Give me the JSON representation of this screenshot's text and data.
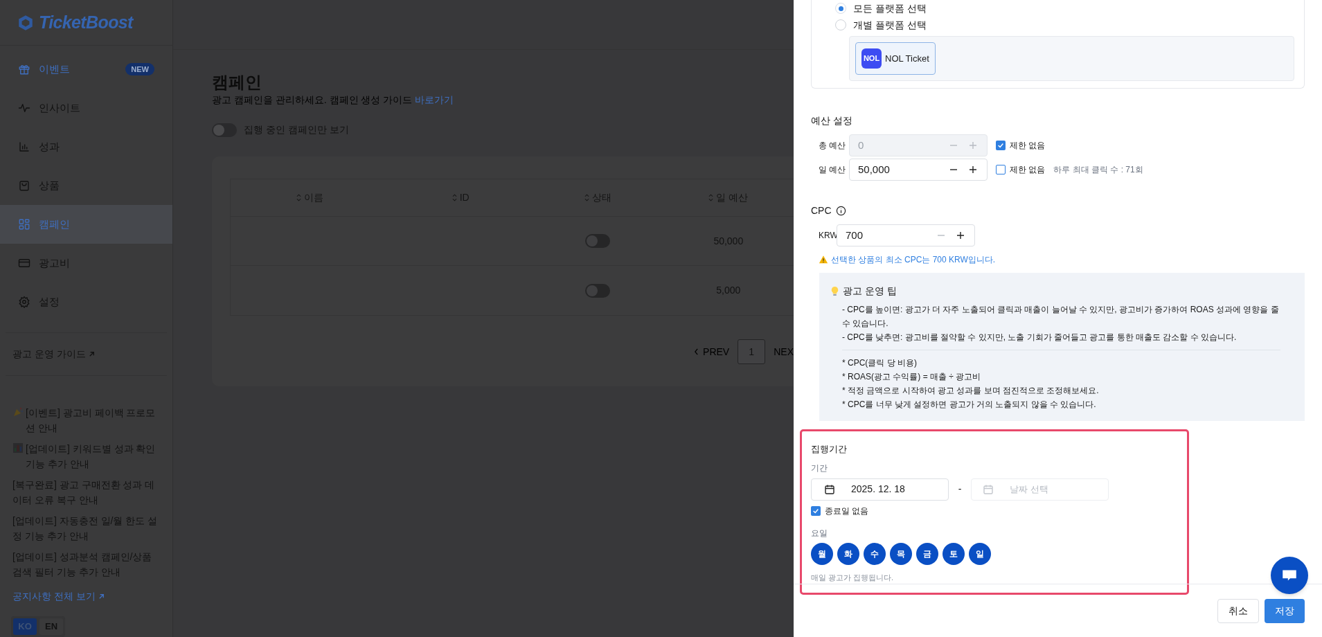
{
  "brand": {
    "name": "TicketBoost"
  },
  "sidebar": {
    "items": [
      {
        "label": "이벤트",
        "badge": "NEW",
        "highlight": true,
        "selected": false
      },
      {
        "label": "인사이트",
        "highlight": false,
        "selected": false
      },
      {
        "label": "성과",
        "highlight": false,
        "selected": false
      },
      {
        "label": "상품",
        "highlight": false,
        "selected": false
      },
      {
        "label": "캠페인",
        "highlight": true,
        "selected": true
      },
      {
        "label": "광고비",
        "highlight": false,
        "selected": false
      },
      {
        "label": "설정",
        "highlight": false,
        "selected": false
      }
    ],
    "guide_link": "광고 운영 가이드",
    "notices": [
      {
        "kind": "party",
        "text": "[이벤트] 광고비 페이백 프로모션 안내"
      },
      {
        "kind": "chart",
        "text": "[업데이트] 키워드별 성과 확인 기능 추가 안내"
      },
      {
        "kind": "plain",
        "text": "[복구완료] 광고 구매전환 성과 데이터 오류 복구 안내"
      },
      {
        "kind": "plain",
        "text": "[업데이트] 자동충전 일/월 한도 설정 기능 추가 안내"
      },
      {
        "kind": "plain",
        "text": "[업데이트] 성과분석 캠페인/상품 검색 필터 기능 추가 안내"
      }
    ],
    "notices_all": "공지사항 전체 보기",
    "languages": [
      {
        "label": "KO",
        "selected": true
      },
      {
        "label": "EN",
        "selected": false
      }
    ]
  },
  "page": {
    "title": "캠페인",
    "subtitle": "광고 캠페인을 관리하세요. 캠페인 생성 가이드",
    "subtitle_link": "바로가기",
    "filter": {
      "label": "집행 중인 캠페인만 보기",
      "on": false
    }
  },
  "table": {
    "columns": [
      "이름",
      "ID",
      "상태",
      "일 예산"
    ],
    "rows": [
      {
        "on": false,
        "daily_budget": "50,000"
      },
      {
        "on": false,
        "daily_budget": "5,000"
      }
    ]
  },
  "pagination": {
    "prev": "PREV",
    "pages": [
      {
        "label": "1",
        "selected": true
      }
    ],
    "next": "NEX"
  },
  "drawer": {
    "platform": {
      "options": [
        {
          "label": "모든 플랫폼 선택",
          "selected": true
        },
        {
          "label": "개별 플랫폼 선택",
          "selected": false
        }
      ],
      "chips": [
        {
          "logo": "NOL",
          "label": "NOL Ticket",
          "selected": true
        }
      ]
    },
    "budget": {
      "title": "예산 설정",
      "rows": [
        {
          "label": "총 예산",
          "value": "0",
          "disabled": true,
          "unlimited": {
            "label": "제한 없음",
            "checked": true
          }
        },
        {
          "label": "일 예산",
          "value": "50,000",
          "disabled": false,
          "unlimited": {
            "label": "제한 없음",
            "checked": false
          },
          "note": "하루 최대 클릭 수 : 71회"
        }
      ]
    },
    "cpc": {
      "title": "CPC",
      "currency": "KRW",
      "value": "700",
      "decrement_disabled": true,
      "warning": "선택한 상품의 최소 CPC는 700 KRW입니다."
    },
    "tips": {
      "title": "광고 운영 팁",
      "lines": [
        "- CPC를 높이면: 광고가 더 자주 노출되어 클릭과 매출이 늘어날 수 있지만, 광고비가 증가하여 ROAS 성과에 영향을 줄 수 있습니다.",
        "- CPC를 낮추면: 광고비를 절약할 수 있지만, 노출 기회가 줄어들고 광고를 통한 매출도 감소할 수 있습니다."
      ],
      "notes": [
        "* CPC(클릭 당 비용)",
        "* ROAS(광고 수익률) = 매출 ÷ 광고비",
        "* 적정 금액으로 시작하여 광고 성과를 보며 점진적으로 조정해보세요.",
        "* CPC를 너무 낮게 설정하면 광고가 거의 노출되지 않을 수 있습니다."
      ]
    },
    "period": {
      "title": "집행기간",
      "range_label": "기간",
      "start": "2025. 12. 18",
      "separator": "-",
      "end_placeholder": "날짜 선택",
      "no_end": {
        "label": "종료일 없음",
        "checked": true
      },
      "days_label": "요일",
      "days": [
        {
          "label": "월",
          "selected": true
        },
        {
          "label": "화",
          "selected": true
        },
        {
          "label": "수",
          "selected": true
        },
        {
          "label": "목",
          "selected": true
        },
        {
          "label": "금",
          "selected": true
        },
        {
          "label": "토",
          "selected": true
        },
        {
          "label": "일",
          "selected": true
        }
      ],
      "hint": "매일 광고가 집행됩니다."
    },
    "actions": [
      {
        "label": "취소",
        "kind": "secondary"
      },
      {
        "label": "저장",
        "kind": "primary"
      }
    ]
  }
}
